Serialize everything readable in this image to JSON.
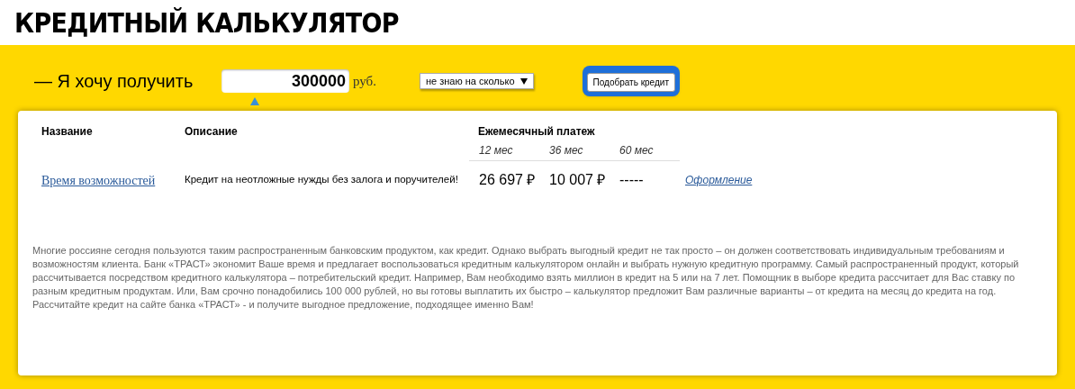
{
  "title": "КРЕДИТНЫЙ КАЛЬКУЛЯТОР",
  "form": {
    "label": "— Я хочу получить",
    "amount": "300000",
    "currency": "руб.",
    "term_select": "не знаю на сколько",
    "submit": "Подобрать кредит"
  },
  "table": {
    "columns": [
      "Название",
      "Описание",
      "Ежемесячный платеж"
    ],
    "terms": [
      "12 мес",
      "36 мес",
      "60 мес"
    ],
    "rows": [
      {
        "name": "Время возможностей",
        "description": "Кредит на неотложные нужды без залога и поручителей!",
        "payments": [
          "26 697 ₽",
          "10 007 ₽",
          "-----"
        ],
        "action": "Оформление"
      }
    ]
  },
  "info_text": "Многие россияне сегодня пользуются таким распространенным банковским продуктом, как кредит. Однако выбрать выгодный кредит не так просто – он должен соответствовать индивидуальным требованиям и возможностям клиента. Банк «ТРАСТ» экономит Ваше время и предлагает воспользоваться кредитным калькулятором онлайн и выбрать нужную кредитную программу. Самый распространенный продукт, который рассчитывается посредством кредитного калькулятора – потребительский кредит. Например, Вам необходимо взять миллион в кредит на 5 или на 7 лет. Помощник в выборе кредита рассчитает для Вас ставку по разным кредитным продуктам. Или, Вам срочно понадобились 100 000 рублей, но вы готовы выплатить их быстро – калькулятор предложит Вам различные варианты – от кредита на месяц до кредита на год. Рассчитайте кредит на сайте банка «ТРАСТ» - и получите выгодное предложение, подходящее именно Вам!"
}
